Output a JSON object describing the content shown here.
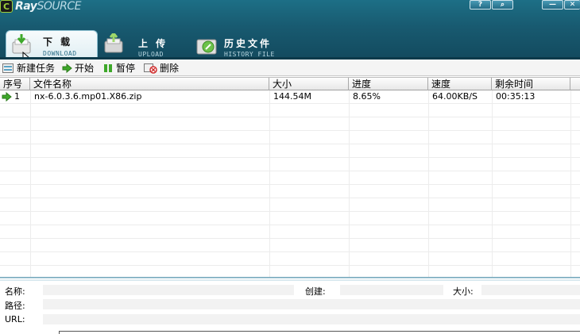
{
  "app": {
    "logo_mark": "C",
    "logo_name_bold": "Ray",
    "logo_name_light": "SOURCE",
    "window_buttons": [
      {
        "label": "?",
        "icon": "help-icon"
      },
      {
        "label": "⌕",
        "icon": "settings-search-icon"
      },
      {
        "label": "—",
        "icon": "minimize-icon"
      },
      {
        "label": "✕",
        "icon": "close-icon"
      }
    ]
  },
  "tabs": [
    {
      "title": "下 载",
      "subtitle": "DOWNLOAD",
      "active": true,
      "icon": "download-icon"
    },
    {
      "title": "上 传",
      "subtitle": "UPLOAD",
      "active": false,
      "icon": "upload-icon"
    },
    {
      "title": "历史文件",
      "subtitle": "HISTORY FILE",
      "active": false,
      "icon": "history-file-icon"
    }
  ],
  "toolbar": {
    "new_task": "新建任务",
    "start": "开始",
    "pause": "暂停",
    "delete": "删除"
  },
  "table": {
    "columns": [
      "序号",
      "文件名称",
      "大小",
      "进度",
      "速度",
      "剩余时间"
    ],
    "rows": [
      {
        "index": "1",
        "name": "nx-6.0.3.6.mp01.X86.zip",
        "size": "144.54M",
        "progress": "8.65%",
        "speed": "64.00KB/S",
        "remaining": "00:35:13",
        "status_icon": "play-arrow-icon"
      }
    ]
  },
  "details": {
    "name_label": "名称:",
    "created_label": "创建:",
    "size_label": "大小:",
    "path_label": "路径:",
    "url_label": "URL:",
    "name_value": "",
    "created_value": "",
    "size_value": "",
    "path_value": "",
    "url_value": ""
  },
  "colors": {
    "header": "#185a70",
    "accent_green": "#3ea82a",
    "active_tab": "#dfeef3"
  }
}
